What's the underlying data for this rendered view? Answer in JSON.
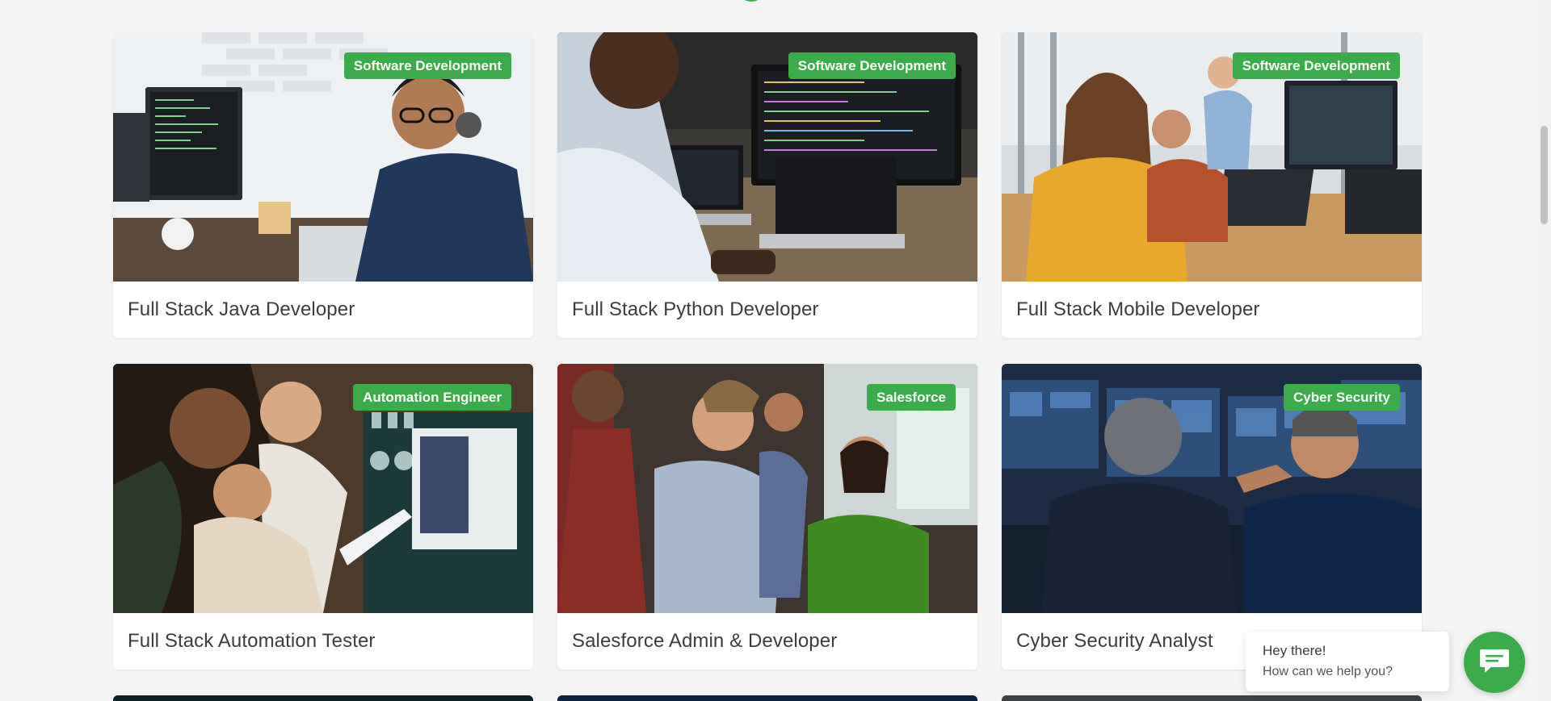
{
  "courses": [
    {
      "title": "Full Stack Java Developer",
      "badge": "Software Development"
    },
    {
      "title": "Full Stack Python Developer",
      "badge": "Software Development"
    },
    {
      "title": "Full Stack Mobile Developer",
      "badge": "Software Development"
    },
    {
      "title": "Full Stack Automation Tester",
      "badge": "Automation Engineer"
    },
    {
      "title": "Salesforce Admin & Developer",
      "badge": "Salesforce"
    },
    {
      "title": "Cyber Security Analyst",
      "badge": "Cyber Security"
    }
  ],
  "chat": {
    "greeting": "Hey there!",
    "prompt": "How can we help you?",
    "icon": "chat-icon"
  },
  "colors": {
    "accent": "#3bab4b",
    "background": "#f4f4f4",
    "title_text": "#3d3d3d"
  }
}
